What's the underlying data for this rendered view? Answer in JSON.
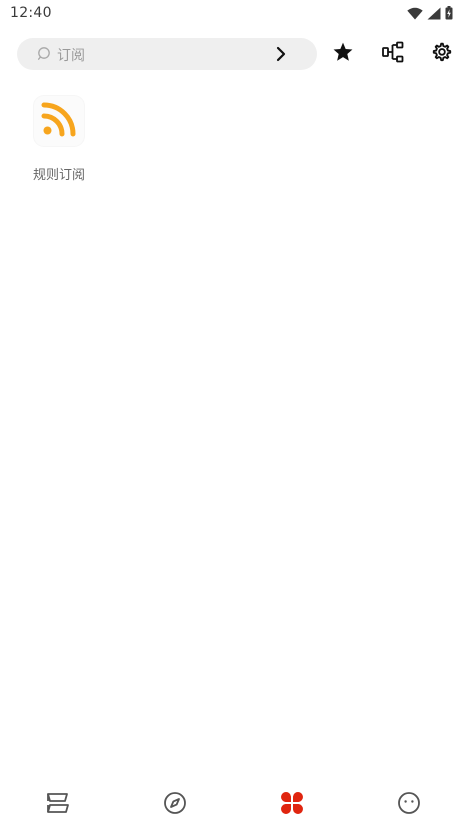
{
  "status_bar": {
    "time": "12:40",
    "icons": [
      "wifi-icon",
      "cellular-signal-icon",
      "battery-charging-icon"
    ]
  },
  "top_bar": {
    "search": {
      "placeholder": "订阅",
      "icon": "search-icon",
      "go_icon": "chevron-right-icon"
    },
    "actions": [
      {
        "name": "favorites",
        "icon": "star-icon"
      },
      {
        "name": "group-tree",
        "icon": "tree-structure-icon"
      },
      {
        "name": "settings",
        "icon": "gear-icon"
      }
    ]
  },
  "grid": {
    "items": [
      {
        "label": "规则订阅",
        "icon": "rss-icon"
      }
    ]
  },
  "bottom_nav": {
    "items": [
      {
        "name": "bookshelf",
        "icon": "bookshelf-icon",
        "active": false
      },
      {
        "name": "explore",
        "icon": "compass-icon",
        "active": false
      },
      {
        "name": "subscriptions",
        "icon": "four-leaf-icon",
        "active": true
      },
      {
        "name": "my",
        "icon": "smiley-face-icon",
        "active": false
      }
    ]
  },
  "colors": {
    "accent": "#e0250f",
    "rss_orange": "#f7a51d",
    "search_bg": "#efefef",
    "icon_dark": "#111111",
    "nav_inactive": "#555555"
  }
}
